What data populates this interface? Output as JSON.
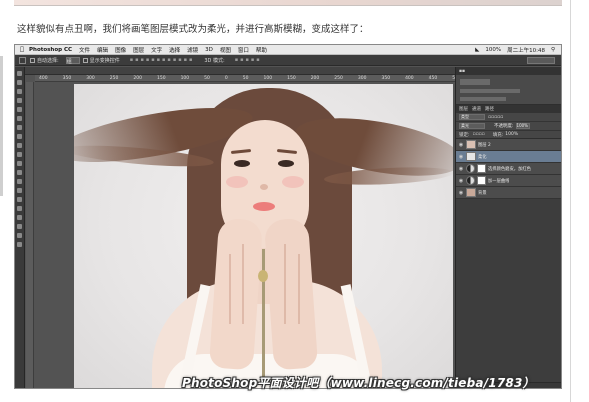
{
  "article": {
    "caption": "这样貌似有点丑啊，我们将画笔图层模式改为柔光，并进行高斯模糊，变成这样了："
  },
  "photoshop": {
    "menubar": {
      "apple_icon": "apple-icon",
      "app_name": "Photoshop CC",
      "menus": [
        "文件",
        "编辑",
        "图像",
        "图层",
        "文字",
        "选择",
        "滤镜",
        "3D",
        "视图",
        "窗口",
        "帮助"
      ],
      "battery": "100%",
      "clock": "周二上午10:48"
    },
    "options_bar": {
      "auto_select_label": "自动选择:",
      "auto_select_value": "组",
      "show_transform_label": "显示变换控件",
      "mode_3d_label": "3D 模式:"
    },
    "ruler_marks": [
      "400",
      "350",
      "300",
      "250",
      "200",
      "150",
      "100",
      "50",
      "0",
      "50",
      "100",
      "150",
      "200",
      "250",
      "300",
      "350",
      "400",
      "450",
      "500"
    ],
    "layers_panel": {
      "tabs": [
        "图层",
        "通道",
        "路径"
      ],
      "kind_filter": "类型",
      "blend_mode": "柔光",
      "opacity_label": "不透明度:",
      "opacity_value": "100%",
      "lock_label": "锁定:",
      "fill_label": "填充:",
      "fill_value": "100%",
      "layers": [
        {
          "name": "图层 2",
          "type": "pixel"
        },
        {
          "name": "柔化",
          "type": "pixel",
          "active": true
        },
        {
          "name": "选择颜色磨皮，加红色",
          "type": "adjustment"
        },
        {
          "name": "加一层曲线",
          "type": "adjustment"
        },
        {
          "name": "背景",
          "type": "pixel"
        }
      ]
    }
  },
  "watermark": "PhotoShop平面设计吧（www.linecg.com/tieba/1783）"
}
